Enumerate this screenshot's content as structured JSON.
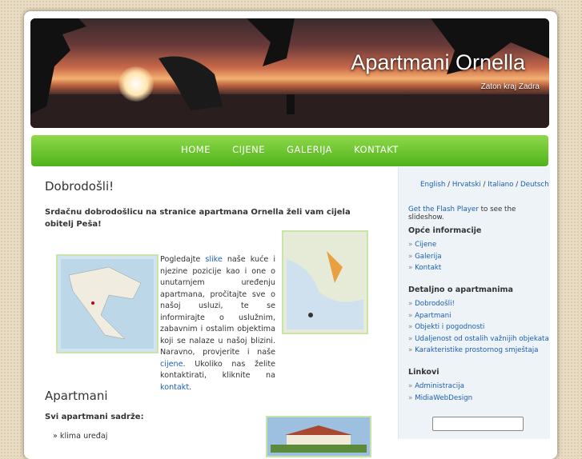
{
  "header": {
    "title": "Apartmani Ornella",
    "subtitle": "Zaton kraj Zadra"
  },
  "nav": [
    "HOME",
    "CIJENE",
    "GALERIJA",
    "KONTAKT"
  ],
  "main": {
    "heading": "Dobrodošli!",
    "intro": "Srdačnu dobrodošlicu na stranice apartmana Ornella želi vam cijela obitelj Peša!",
    "text_1": "Pogledajte ",
    "link_slike": "slike",
    "text_2": " naše kuće i njezine pozicije kao i one o unutarnjem uređenju apartmana, pročitajte sve o našoj usluzi, te se informirajte o uslužnim, zabavnim i ostalim objektima koji se nalaze u našoj blizini. Naravno, provjerite i naše ",
    "link_cijene": "cijene",
    "text_3": ". Ukoliko nas želite kontaktirati, kliknite na ",
    "link_kontakt": "kontakt",
    "text_4": ".",
    "heading2": "Apartmani",
    "sub2": "Svi apartmani sadrže:",
    "list": [
      "klima uređaj"
    ]
  },
  "sidebar": {
    "langs": [
      "English",
      "Hrvatski",
      "Italiano",
      "Deutsch"
    ],
    "flash_link": "Get the Flash Player",
    "flash_text": " to see the slideshow.",
    "sections": [
      {
        "title": "Opće informacije",
        "items": [
          "Cijene",
          "Galerija",
          "Kontakt"
        ]
      },
      {
        "title": "Detaljno o apartmanima",
        "items": [
          "Dobrodošli!",
          "Apartmani",
          "Objekti i pogodnosti",
          "Udaljenost od ostalih važnijih objekata",
          "Karakteristike prostornog smještaja"
        ]
      },
      {
        "title": "Linkovi",
        "items": [
          "Administracija",
          "MidiaWebDesign"
        ]
      }
    ]
  }
}
